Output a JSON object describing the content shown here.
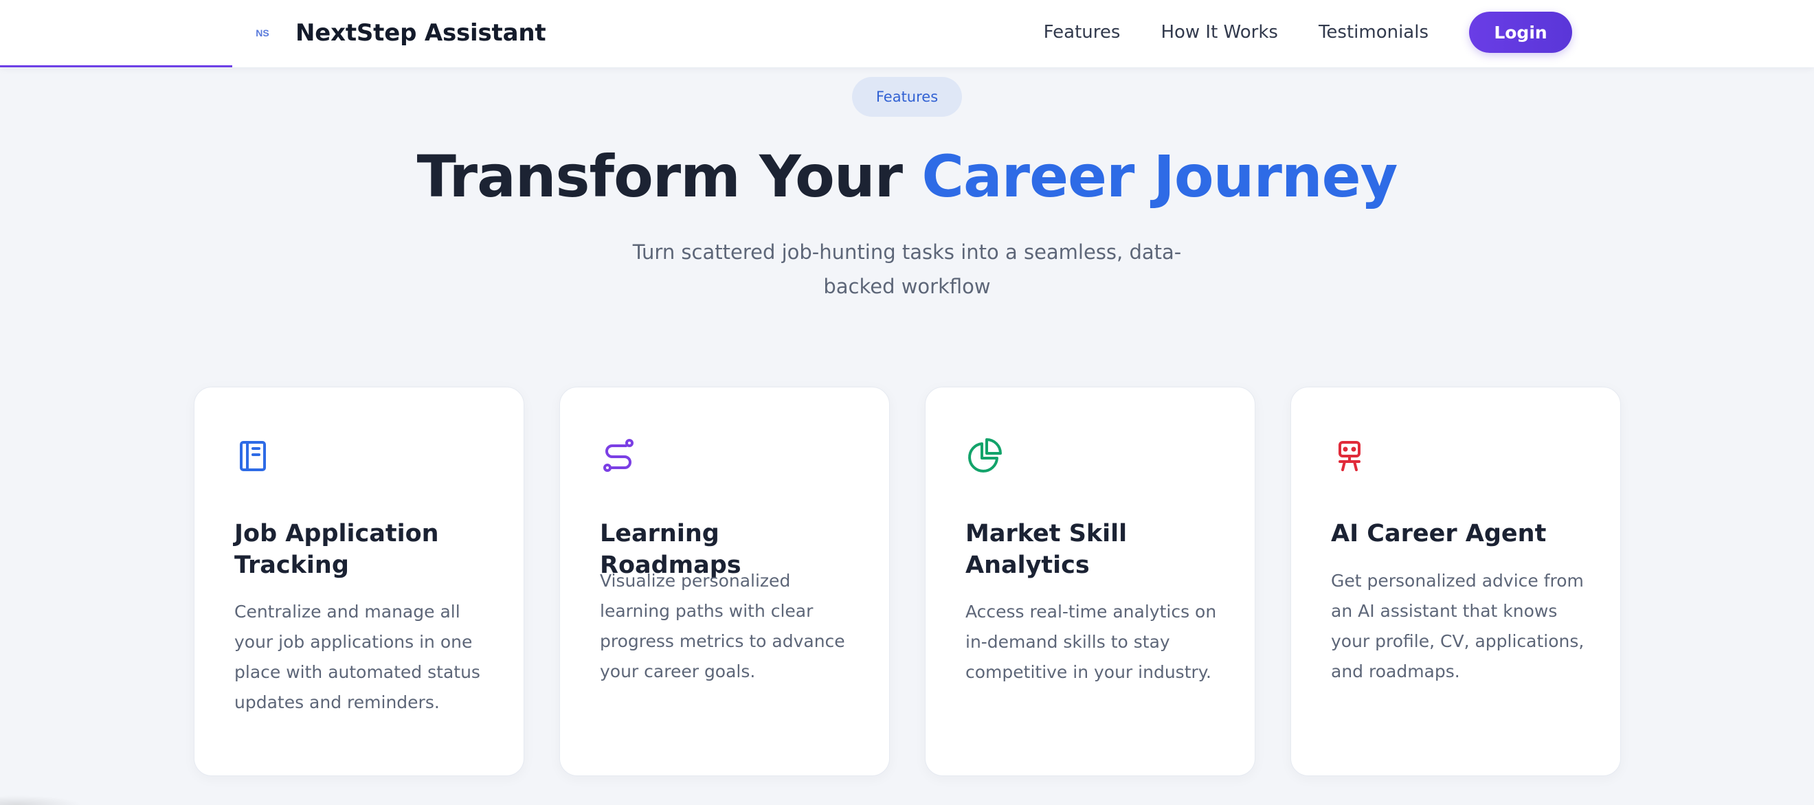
{
  "header": {
    "brand_logo_text": "NS",
    "brand_name": "NextStep Assistant",
    "nav": [
      "Features",
      "How It Works",
      "Testimonials"
    ],
    "login_label": "Login",
    "scroll_progress": 0.128
  },
  "hero": {
    "badge": "Features",
    "title_part1": "Transform Your",
    "title_accent": "Career Journey",
    "subtitle": "Turn scattered job-hunting tasks into a seamless, data-backed workflow"
  },
  "cards": [
    {
      "icon": "notebook-icon",
      "icon_color": "#2e6be6",
      "title": "Job Application Tracking",
      "description": "Centralize and manage all your job applications in one place with automated status updates and reminders."
    },
    {
      "icon": "route-icon",
      "icon_color": "#7b3fe4",
      "title": "Learning Roadmaps",
      "description": "Visualize personalized learning paths with clear progress metrics to advance your career goals."
    },
    {
      "icon": "pie-chart-icon",
      "icon_color": "#12a36a",
      "title": "Market Skill Analytics",
      "description": "Access real-time analytics on in-demand skills to stay competitive in your industry."
    },
    {
      "icon": "robot-icon",
      "icon_color": "#e02b3a",
      "title": "AI Career Agent",
      "description": "Get personalized advice from an AI assistant that knows your profile, CV, applications, and roadmaps."
    }
  ],
  "colors": {
    "brand_purple": "#6a3de6",
    "accent_blue": "#2e6be6",
    "background": "#f3f5f9"
  }
}
